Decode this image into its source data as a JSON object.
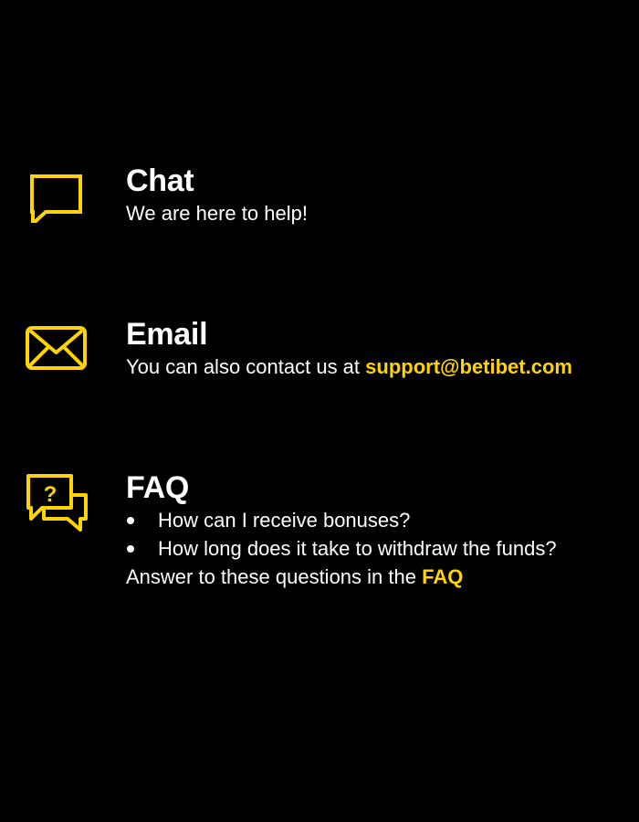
{
  "colors": {
    "background": "#000000",
    "text": "#ffffff",
    "accent": "#ffd400"
  },
  "chat": {
    "icon": "chat-bubble-icon",
    "title": "Chat",
    "text": "We are here to help!"
  },
  "email": {
    "icon": "envelope-icon",
    "title": "Email",
    "text": "You can also contact us at ",
    "address": "support@betibet.com"
  },
  "faq": {
    "icon": "faq-chat-bubbles-icon",
    "title": "FAQ",
    "questions": [
      "How can I receive bonuses?",
      "How long does it take to withdraw the funds?"
    ],
    "answer_text": "Answer to these questions in the ",
    "answer_link": "FAQ"
  }
}
